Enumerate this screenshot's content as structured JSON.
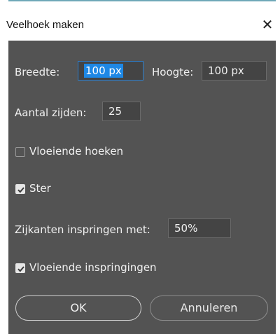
{
  "window": {
    "title": "Veelhoek maken",
    "close_glyph": "✕"
  },
  "fields": {
    "width_label": "Breedte:",
    "width_value": "100 px",
    "height_label": "Hoogte:",
    "height_value": "100 px",
    "sides_label": "Aantal zijden:",
    "sides_value": "25",
    "indent_label": "Zijkanten inspringen met:",
    "indent_value": "50%"
  },
  "options": {
    "smooth_corners": {
      "label": "Vloeiende hoeken",
      "checked": false
    },
    "star": {
      "label": "Ster",
      "checked": true
    },
    "smooth_indents": {
      "label": "Vloeiende inspringingen",
      "checked": true
    }
  },
  "buttons": {
    "ok": "OK",
    "cancel": "Annuleren"
  },
  "colors": {
    "panel": "#535353",
    "focus": "#2b7fd0",
    "selection": "#1e88e5"
  }
}
